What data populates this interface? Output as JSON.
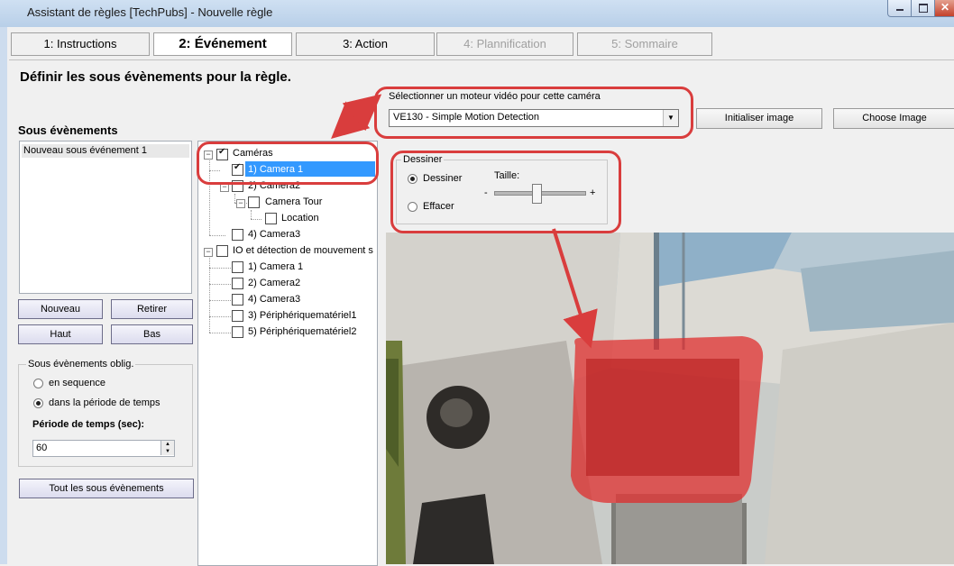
{
  "window": {
    "title": "Assistant de règles [TechPubs] - Nouvelle règle"
  },
  "steps": [
    {
      "label": "1: Instructions"
    },
    {
      "label": "2: Événement"
    },
    {
      "label": "3: Action"
    },
    {
      "label": "4: Plannification"
    },
    {
      "label": "5: Sommaire"
    }
  ],
  "page": {
    "heading": "Définir les sous évènements pour la règle."
  },
  "subevents": {
    "title": "Sous évènements",
    "items": [
      "Nouveau sous événement 1"
    ],
    "buttons": {
      "new": "Nouveau",
      "remove": "Retirer",
      "up": "Haut",
      "down": "Bas"
    },
    "required_group": {
      "title": "Sous évènements oblig.",
      "option_sequence": "en sequence",
      "option_period": "dans la période de temps",
      "selected": "dans la période de temps",
      "period_label": "Période de temps (sec):",
      "period_value": "60"
    },
    "all_button": "Tout les sous évènements"
  },
  "tree": {
    "cameras_root": "Caméras",
    "camera1": "1) Camera 1",
    "camera2": "2) Camera2",
    "camera_tour": "Camera Tour",
    "location": "Location",
    "camera3": "4) Camera3",
    "io_root": "IO et détection de mouvement s",
    "io_camera1": "1) Camera 1",
    "io_camera2": "2) Camera2",
    "io_camera3": "4) Camera3",
    "io_device1": "3) Périphériquematériel1",
    "io_device2": "5) Périphériquematériel2"
  },
  "video_engine": {
    "label": "Sélectionner un moteur vidéo pour cette caméra",
    "selected": "VE130 - Simple Motion Detection",
    "init_button": "Initialiser image",
    "choose_button": "Choose Image"
  },
  "draw": {
    "group_title": "Dessiner",
    "draw_option": "Dessiner",
    "erase_option": "Effacer",
    "selected": "Dessiner",
    "size_label": "Taille:",
    "minus": "-",
    "plus": "+"
  },
  "colors": {
    "annotation": "#d93d3d",
    "selection": "#3399ff",
    "mask": "#e02828"
  },
  "icons": [
    "minimize-icon",
    "maximize-icon",
    "close-icon",
    "checkbox-icon",
    "expand-collapse-icon",
    "dropdown-arrow-icon"
  ]
}
